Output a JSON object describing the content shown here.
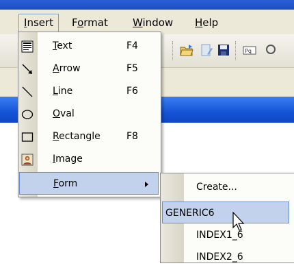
{
  "menubar": {
    "items": [
      {
        "label": "Insert",
        "mnemonic": "I"
      },
      {
        "label": "Format",
        "mnemonic": "o"
      },
      {
        "label": "Window",
        "mnemonic": "W"
      },
      {
        "label": "Help",
        "mnemonic": "H"
      }
    ],
    "active": "Insert"
  },
  "toolbar": {
    "icons": [
      "open-folder-icon",
      "edit-document-icon",
      "save-floppy-icon",
      "toolbar-tool-icon",
      "search-icon"
    ]
  },
  "insert_menu": {
    "items": [
      {
        "pre": "",
        "mn": "T",
        "post": "ext",
        "shortcut": "F4",
        "icon": "text-frame-icon"
      },
      {
        "pre": "",
        "mn": "A",
        "post": "rrow",
        "shortcut": "F5",
        "icon": "arrow-icon"
      },
      {
        "pre": "",
        "mn": "L",
        "post": "ine",
        "shortcut": "F6",
        "icon": "line-icon"
      },
      {
        "pre": "",
        "mn": "O",
        "post": "val",
        "shortcut": "",
        "icon": "oval-icon"
      },
      {
        "pre": "",
        "mn": "R",
        "post": "ectangle",
        "shortcut": "F8",
        "icon": "rectangle-icon"
      },
      {
        "pre": "",
        "mn": "I",
        "post": "mage",
        "shortcut": "",
        "icon": "image-icon"
      },
      {
        "pre": "",
        "mn": "F",
        "post": "orm",
        "shortcut": "",
        "icon": "",
        "submenu": true,
        "highlighted": true
      }
    ]
  },
  "form_submenu": {
    "items": [
      {
        "label": "Create..."
      },
      {
        "label": "GENERIC6",
        "highlighted": true
      },
      {
        "label": "INDEX1_6"
      },
      {
        "label": "INDEX2_6"
      }
    ]
  },
  "colors": {
    "menu_bg": "#ece9d8",
    "highlight": "#c2d1ec",
    "highlight_border": "#6a8ccc",
    "title_blue": "#1554d6"
  }
}
